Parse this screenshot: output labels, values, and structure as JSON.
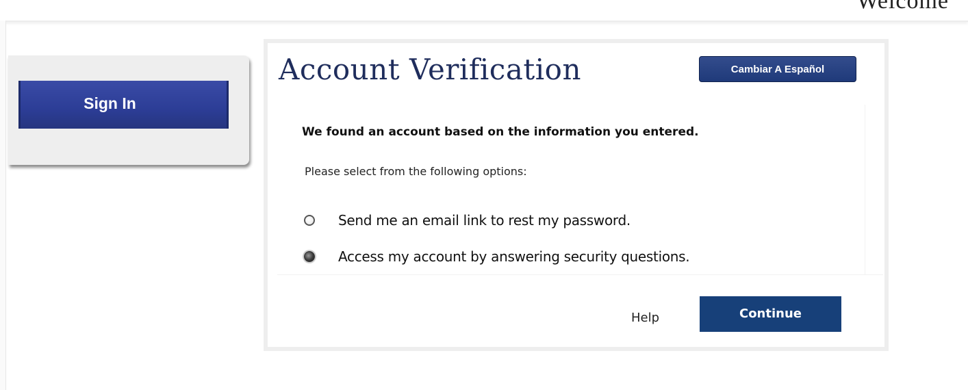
{
  "header": {
    "welcome_text": "Welcome"
  },
  "signin_panel": {
    "button_label": "Sign In"
  },
  "dialog": {
    "title": "Account Verification",
    "language_button_label": "Cambiar A Español",
    "found_message": "We found an account based on the information you entered.",
    "select_prompt": "Please select from the following options:",
    "options": [
      {
        "label": "Send me an email link to rest my password.",
        "selected": false
      },
      {
        "label": "Access my account by answering security questions.",
        "selected": true
      }
    ],
    "footer": {
      "help_label": "Help",
      "continue_label": "Continue"
    }
  },
  "colors": {
    "title_navy": "#1f2d5c",
    "button_blue": "#174079",
    "signin_blue": "#2c3d96",
    "panel_gray": "#eeeeee"
  }
}
